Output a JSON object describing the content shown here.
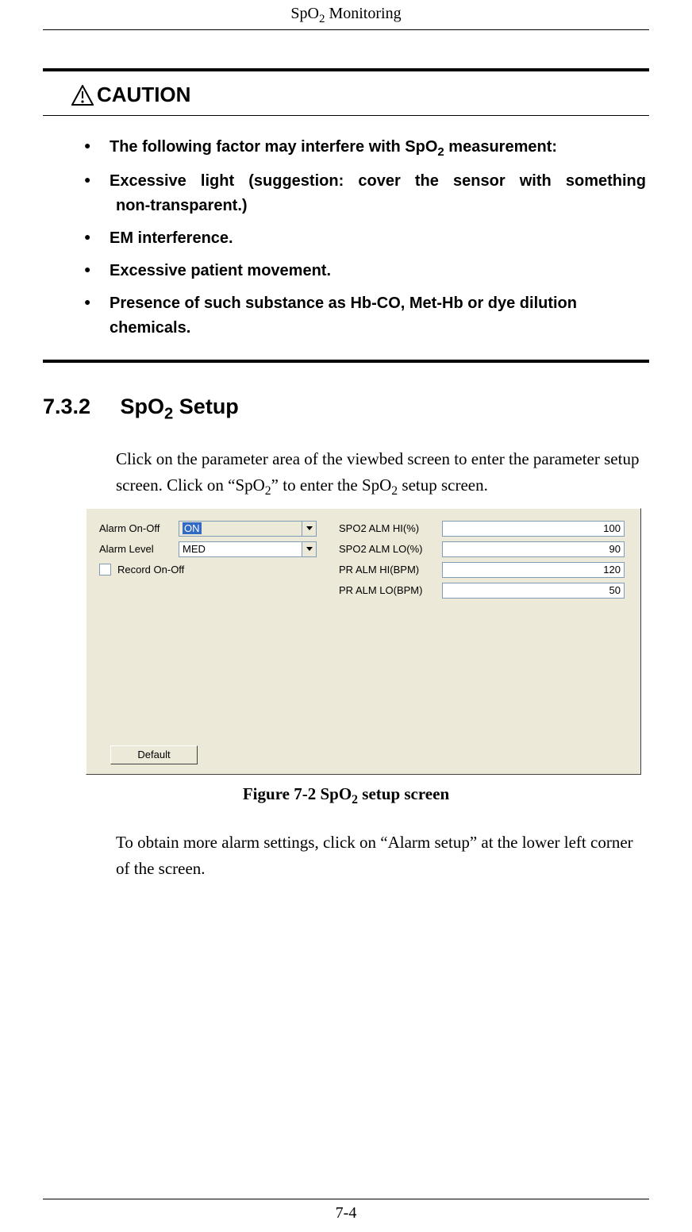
{
  "header": {
    "title_pre": "SpO",
    "title_sub": "2",
    "title_post": " Monitoring"
  },
  "caution": {
    "heading": "CAUTION",
    "items": [
      {
        "pre": "The following factor may interfere with SpO",
        "sub": "2",
        "post": " measurement:"
      },
      {
        "line1": "Excessive light (suggestion: cover the sensor with something",
        "line2": "non-transparent.)"
      },
      {
        "text": "EM interference."
      },
      {
        "text": "Excessive patient movement."
      },
      {
        "text": "Presence of such substance as Hb-CO, Met-Hb or dye dilution chemicals."
      }
    ]
  },
  "section": {
    "num": "7.3.2",
    "title_pre": "SpO",
    "title_sub": "2",
    "title_post": " Setup",
    "paraA_1": "Click on the parameter area of the viewbed screen to enter the parameter setup screen. Click on “SpO",
    "paraA_sub": "2",
    "paraA_2": "” to enter the SpO",
    "paraA_sub2": "2",
    "paraA_3": " setup screen.",
    "paraB": "To obtain more alarm settings, click on “Alarm setup” at the lower left corner of the screen."
  },
  "figure_caption": {
    "pre": "Figure 7-2 SpO",
    "sub": "2",
    "post": " setup screen"
  },
  "shot": {
    "left": {
      "alarm_onoff_label": "Alarm On-Off",
      "alarm_onoff_value": "ON",
      "alarm_level_label": "Alarm Level",
      "alarm_level_value": "MED",
      "record_label": "Record On-Off"
    },
    "right": {
      "spo2_hi_label": "SPO2 ALM HI(%)",
      "spo2_hi_value": "100",
      "spo2_lo_label": "SPO2 ALM LO(%)",
      "spo2_lo_value": "90",
      "pr_hi_label": "PR ALM HI(BPM)",
      "pr_hi_value": "120",
      "pr_lo_label": "PR ALM LO(BPM)",
      "pr_lo_value": "50"
    },
    "default_btn": "Default"
  },
  "footer": {
    "page": "7-4"
  }
}
